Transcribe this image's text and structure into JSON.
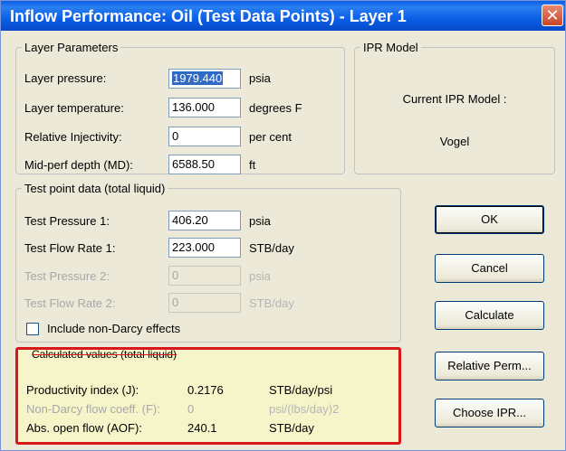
{
  "window": {
    "title": "Inflow Performance: Oil (Test Data Points) - Layer 1",
    "close_glyph": "✕"
  },
  "layer_parameters": {
    "legend": "Layer Parameters",
    "rows": [
      {
        "label": "Layer pressure:",
        "value": "1979.440",
        "unit": "psia"
      },
      {
        "label": "Layer temperature:",
        "value": "136.000",
        "unit": "degrees F"
      },
      {
        "label": "Relative Injectivity:",
        "value": "0",
        "unit": "per cent"
      },
      {
        "label": "Mid-perf depth (MD):",
        "value": "6588.50",
        "unit": "ft"
      }
    ]
  },
  "ipr_model": {
    "legend": "IPR Model",
    "current_label": "Current IPR Model :",
    "model": "Vogel"
  },
  "test_point_data": {
    "legend": "Test point data (total liquid)",
    "rows": [
      {
        "label": "Test Pressure 1:",
        "value": "406.20",
        "unit": "psia",
        "enabled": true
      },
      {
        "label": "Test Flow Rate 1:",
        "value": "223.000",
        "unit": "STB/day",
        "enabled": true
      },
      {
        "label": "Test Pressure 2:",
        "value": "0",
        "unit": "psia",
        "enabled": false
      },
      {
        "label": "Test Flow Rate 2:",
        "value": "0",
        "unit": "STB/day",
        "enabled": false
      }
    ],
    "non_darcy_label": "Include non-Darcy effects",
    "non_darcy_checked": false
  },
  "calculated_values": {
    "legend": "Calculated values (total liquid)",
    "rows": [
      {
        "label": "Productivity index (J):",
        "value": "0.2176",
        "unit": "STB/day/psi"
      },
      {
        "label": "Non-Darcy flow coeff. (F):",
        "value": "0",
        "unit": "psi/(lbs/day)2"
      },
      {
        "label": "Abs. open flow (AOF):",
        "value": "240.1",
        "unit": "STB/day"
      }
    ]
  },
  "buttons": {
    "ok": "OK",
    "cancel": "Cancel",
    "calculate": "Calculate",
    "relative_perm": "Relative Perm...",
    "choose_ipr": "Choose IPR..."
  }
}
